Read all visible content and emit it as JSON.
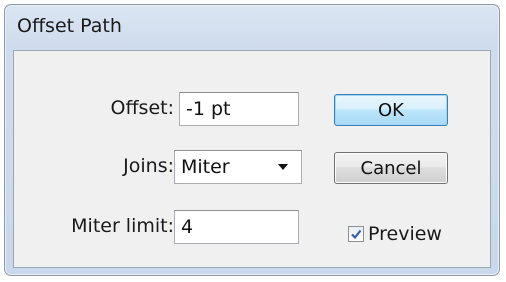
{
  "dialog": {
    "title": "Offset Path"
  },
  "fields": {
    "offset_label": "Offset:",
    "offset_value": "-1 pt",
    "joins_label": "Joins:",
    "joins_value": "Miter",
    "miter_limit_label": "Miter limit:",
    "miter_limit_value": "4"
  },
  "buttons": {
    "ok_label": "OK",
    "cancel_label": "Cancel"
  },
  "preview": {
    "label": "Preview",
    "checked": true
  },
  "icons": {
    "joins_dropdown": "chevron-down-icon",
    "preview_check": "checkmark-icon"
  },
  "colors": {
    "ok_button_accent": "#a7d9f5",
    "check_color": "#3a5fa8"
  }
}
